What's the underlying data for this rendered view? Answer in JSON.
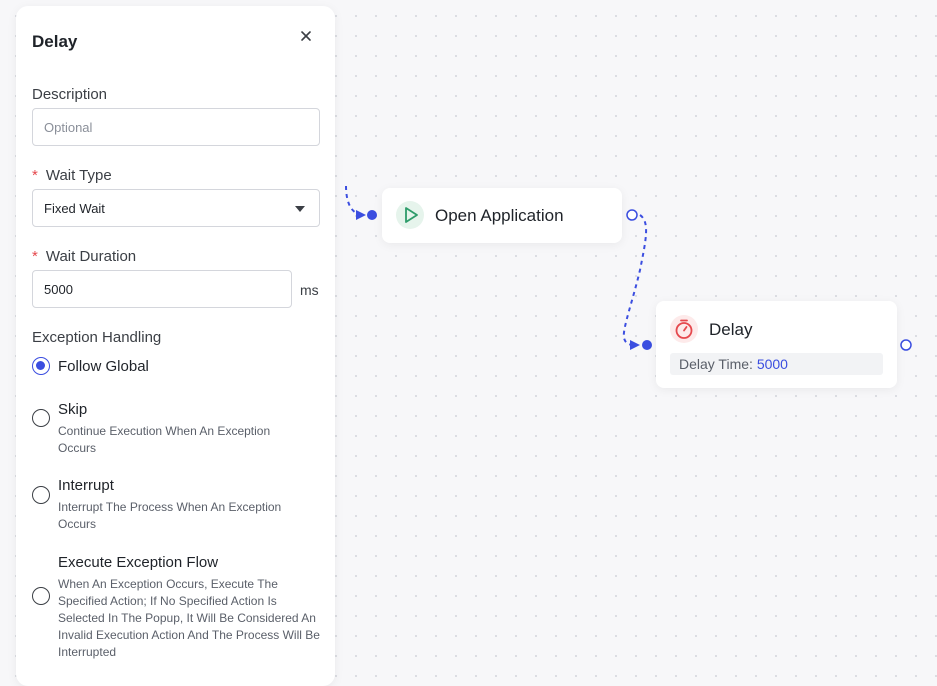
{
  "panel": {
    "title": "Delay",
    "description_label": "Description",
    "description_placeholder": "Optional",
    "wait_type_label": "Wait Type",
    "wait_type_value": "Fixed Wait",
    "wait_duration_label": "Wait Duration",
    "wait_duration_value": "5000",
    "wait_duration_unit": "ms",
    "exception_label": "Exception Handling",
    "required_mark": "*",
    "options": [
      {
        "title": "Follow Global",
        "desc": "",
        "checked": true
      },
      {
        "title": "Skip",
        "desc": "Continue Execution When An Exception Occurs",
        "checked": false
      },
      {
        "title": "Interrupt",
        "desc": "Interrupt The Process When An Exception Occurs",
        "checked": false
      },
      {
        "title": "Execute Exception Flow",
        "desc": "When An Exception Occurs, Execute The Specified Action; If No Specified Action Is Selected In The Popup, It Will Be Considered An Invalid Execution Action And The Process Will Be Interrupted",
        "checked": false
      }
    ]
  },
  "canvas": {
    "nodes": [
      {
        "title": "Open Application",
        "icon": "play-icon"
      },
      {
        "title": "Delay",
        "icon": "timer-icon",
        "prop_label": "Delay Time:",
        "prop_value": "5000"
      }
    ]
  },
  "colors": {
    "accent": "#3b4ee0",
    "required": "#e5484d",
    "play_icon": "#2e9c6a",
    "timer_icon": "#e5484d"
  }
}
